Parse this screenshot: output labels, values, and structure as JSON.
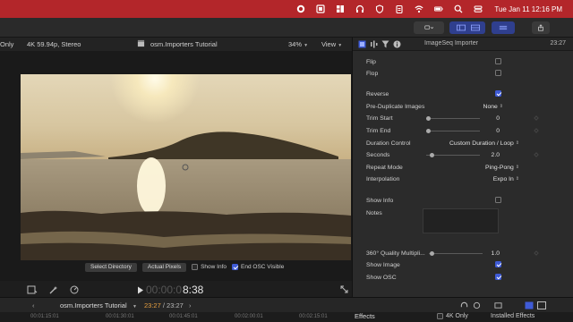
{
  "menubar": {
    "icons": [
      "record-icon",
      "screenshot-icon",
      "grid-icon",
      "headphones-icon",
      "shield-icon",
      "clipboard-icon",
      "wifi-icon",
      "battery-icon",
      "search-icon",
      "control-center-icon"
    ],
    "clock": "Tue Jan 11  12:16 PM"
  },
  "viewer": {
    "left_clip": "Only",
    "format": "4K 59.94p, Stereo",
    "title": "osm.Importers Tutorial",
    "zoom": "34%",
    "view_label": "View",
    "overlay": {
      "select_directory": "Select Directory",
      "actual_pixels": "Actual Pixels",
      "show_info": "Show Info",
      "end_osc": "End OSC Visible"
    },
    "timecode_dim": "00:00:0",
    "timecode": "8:38"
  },
  "inspector": {
    "title": "ImageSeq Importer",
    "duration": "23:27",
    "rows": {
      "flip": "Flip",
      "flop": "Flop",
      "reverse": "Reverse",
      "pre_duplicate": "Pre-Duplicate Images",
      "pre_duplicate_value": "None",
      "trim_start": "Trim Start",
      "trim_start_value": "0",
      "trim_end": "Trim End",
      "trim_end_value": "0",
      "duration_control": "Duration Control",
      "duration_control_value": "Custom Duration / Loop",
      "seconds": "Seconds",
      "seconds_value": "2.0",
      "repeat_mode": "Repeat Mode",
      "repeat_mode_value": "Ping-Pong",
      "interpolation": "Interpolation",
      "interpolation_value": "Expo In",
      "show_info": "Show Info",
      "notes": "Notes",
      "quality": "360° Quality Multipli...",
      "quality_value": "1.0",
      "show_image": "Show Image",
      "show_osc": "Show OSC"
    }
  },
  "timeline": {
    "title": "osm.Importers Tutorial",
    "time_current": "23:27",
    "time_total": "23:27",
    "effects_label": "Effects",
    "filter_4k": "4K Only",
    "installed": "Installed Effects",
    "ruler": [
      "00:01:15:01",
      "00:01:30:01",
      "00:01:45:01",
      "00:02:00:01",
      "00:02:15:01",
      "00:02:30:01"
    ]
  },
  "colors": {
    "menubar": "#b3262a",
    "accent": "#3f5bd6"
  }
}
